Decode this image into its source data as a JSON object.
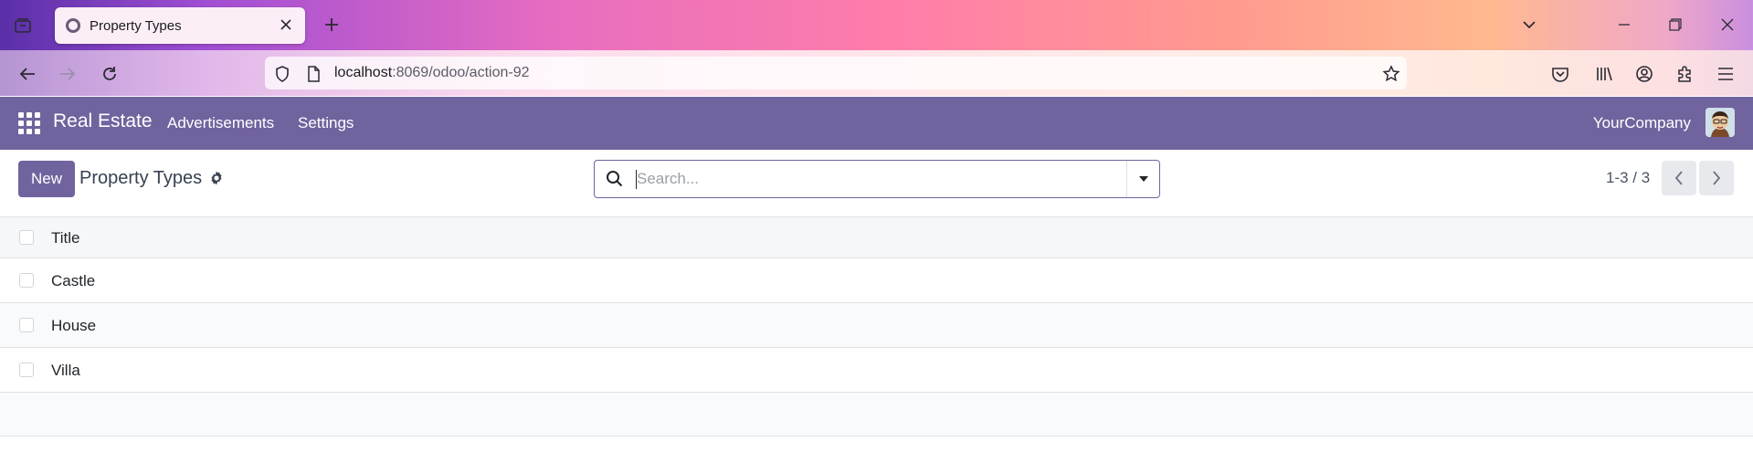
{
  "browser": {
    "tab_title": "Property Types",
    "url_host": "localhost",
    "url_rest": ":8069/odoo/action-92"
  },
  "odoo": {
    "app_name": "Real Estate",
    "menu": [
      "Advertisements",
      "Settings"
    ],
    "company": "YourCompany",
    "accent_color": "#71639e"
  },
  "control_panel": {
    "new_label": "New",
    "breadcrumb": "Property Types",
    "search_placeholder": "Search...",
    "pager": "1-3 / 3"
  },
  "list": {
    "column_header": "Title",
    "rows": [
      "Castle",
      "House",
      "Villa"
    ]
  }
}
